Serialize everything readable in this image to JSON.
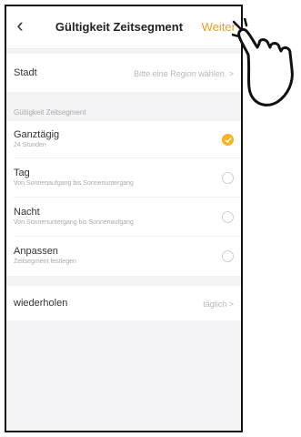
{
  "nav": {
    "back_icon": "chevron-left-icon",
    "back_glyph": "‹",
    "title": "Gültigkeit Zeitsegment",
    "next_label": "Weiter",
    "accent_color": "#f0a020"
  },
  "city": {
    "label": "Stadt",
    "value": "Bitte eine Region wählen. >"
  },
  "section": {
    "header": "Gültigkeit Zeitsegment"
  },
  "options": [
    {
      "title": "Ganztägig",
      "subtitle": "24 Stunden",
      "selected": true
    },
    {
      "title": "Tag",
      "subtitle": "Von Sonnenaufgang bis Sonnenuntergang",
      "selected": false
    },
    {
      "title": "Nacht",
      "subtitle": "Von Sonnenuntergang bis Sonnenaufgang",
      "selected": false
    },
    {
      "title": "Anpassen",
      "subtitle": "Zeitsegment festlegen",
      "selected": false
    }
  ],
  "repeat": {
    "label": "wiederholen",
    "value": "täglich >"
  },
  "overlay": {
    "icon": "pointing-hand-icon"
  }
}
